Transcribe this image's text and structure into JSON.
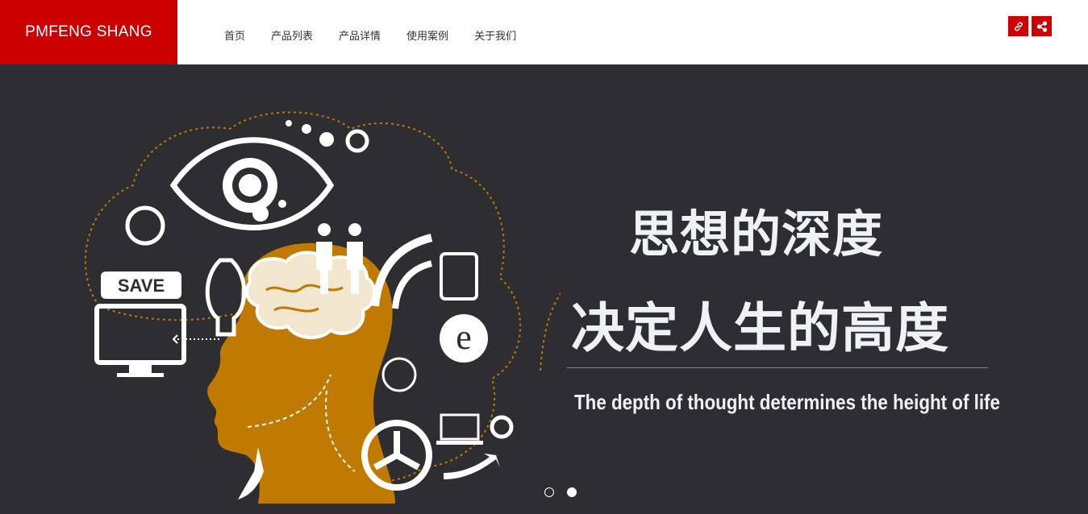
{
  "brand": {
    "name": "PMFENG SHANG"
  },
  "nav": {
    "items": [
      "首页",
      "产品列表",
      "产品详情",
      "使用案例",
      "关于我们"
    ]
  },
  "header_actions": [
    "link-icon",
    "share-icon"
  ],
  "hero": {
    "headline_line1": "思想的深度",
    "headline_line2": "决定人生的高度",
    "subline": "The depth of thought determines the height of life",
    "art_label": "SAVE",
    "slides": {
      "count": 2,
      "active_index": 1
    }
  },
  "colors": {
    "brand_red": "#cc0000",
    "hero_bg": "#2e2d32",
    "accent_orange": "#c07a00",
    "headline": "#eef2f7"
  }
}
